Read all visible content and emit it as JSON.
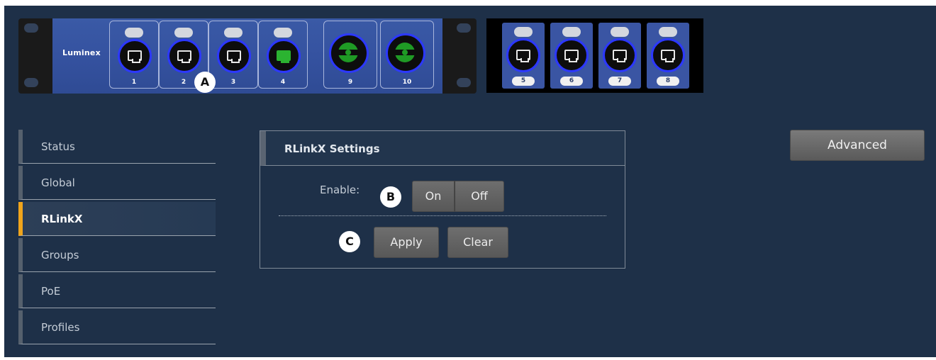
{
  "device": {
    "brand": "Luminex",
    "front_ports": [
      {
        "label": "1",
        "type": "rj45",
        "color": "#e8e8e8"
      },
      {
        "label": "2",
        "type": "rj45",
        "color": "#e8e8e8"
      },
      {
        "label": "3",
        "type": "rj45",
        "color": "#e8e8e8"
      },
      {
        "label": "4",
        "type": "rj45",
        "color": "#2bb331"
      },
      {
        "label": "9",
        "type": "fiber",
        "color": "#1f9a25"
      },
      {
        "label": "10",
        "type": "fiber",
        "color": "#1f9a25"
      }
    ],
    "expansion_ports": [
      {
        "label": "5"
      },
      {
        "label": "6"
      },
      {
        "label": "7"
      },
      {
        "label": "8"
      }
    ]
  },
  "callouts": {
    "a": "A",
    "b": "B",
    "c": "C"
  },
  "sidebar": {
    "items": [
      {
        "label": "Status",
        "active": false
      },
      {
        "label": "Global",
        "active": false
      },
      {
        "label": "RLinkX",
        "active": true
      },
      {
        "label": "Groups",
        "active": false
      },
      {
        "label": "PoE",
        "active": false
      },
      {
        "label": "Profiles",
        "active": false
      }
    ]
  },
  "panel": {
    "title": "RLinkX Settings",
    "enable_label": "Enable:",
    "on_label": "On",
    "off_label": "Off",
    "apply_label": "Apply",
    "clear_label": "Clear"
  },
  "advanced_label": "Advanced",
  "colors": {
    "background": "#1e3048",
    "device_blue": "#3552a0",
    "active_accent": "#f0a51c",
    "port_ring": "#2c38ff"
  }
}
